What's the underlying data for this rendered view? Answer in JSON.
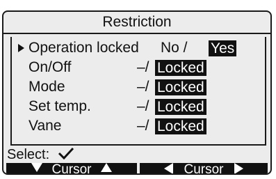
{
  "title": "Restriction",
  "menu": {
    "rows": [
      {
        "label": "Operation locked",
        "options_prefix": "No /",
        "selected": "Yes",
        "active": true
      },
      {
        "label": "On/Off",
        "options_prefix": "–/",
        "selected": "Locked"
      },
      {
        "label": "Mode",
        "options_prefix": "–/",
        "selected": "Locked"
      },
      {
        "label": "Set temp.",
        "options_prefix": "–/",
        "selected": "Locked"
      },
      {
        "label": "Vane",
        "options_prefix": "–/",
        "selected": "Locked"
      }
    ]
  },
  "select_line": {
    "label": "Select:",
    "icon": "checkmark-icon"
  },
  "footer": {
    "left_button": {
      "label": "Cursor",
      "icons": [
        "triangle-down-icon",
        "triangle-up-icon"
      ]
    },
    "right_button": {
      "label": "Cursor",
      "icons": [
        "triangle-left-icon",
        "triangle-right-icon"
      ]
    }
  },
  "colors": {
    "screen_bg": "#ececec",
    "highlight_bg": "#111111",
    "highlight_fg": "#ffffff"
  }
}
